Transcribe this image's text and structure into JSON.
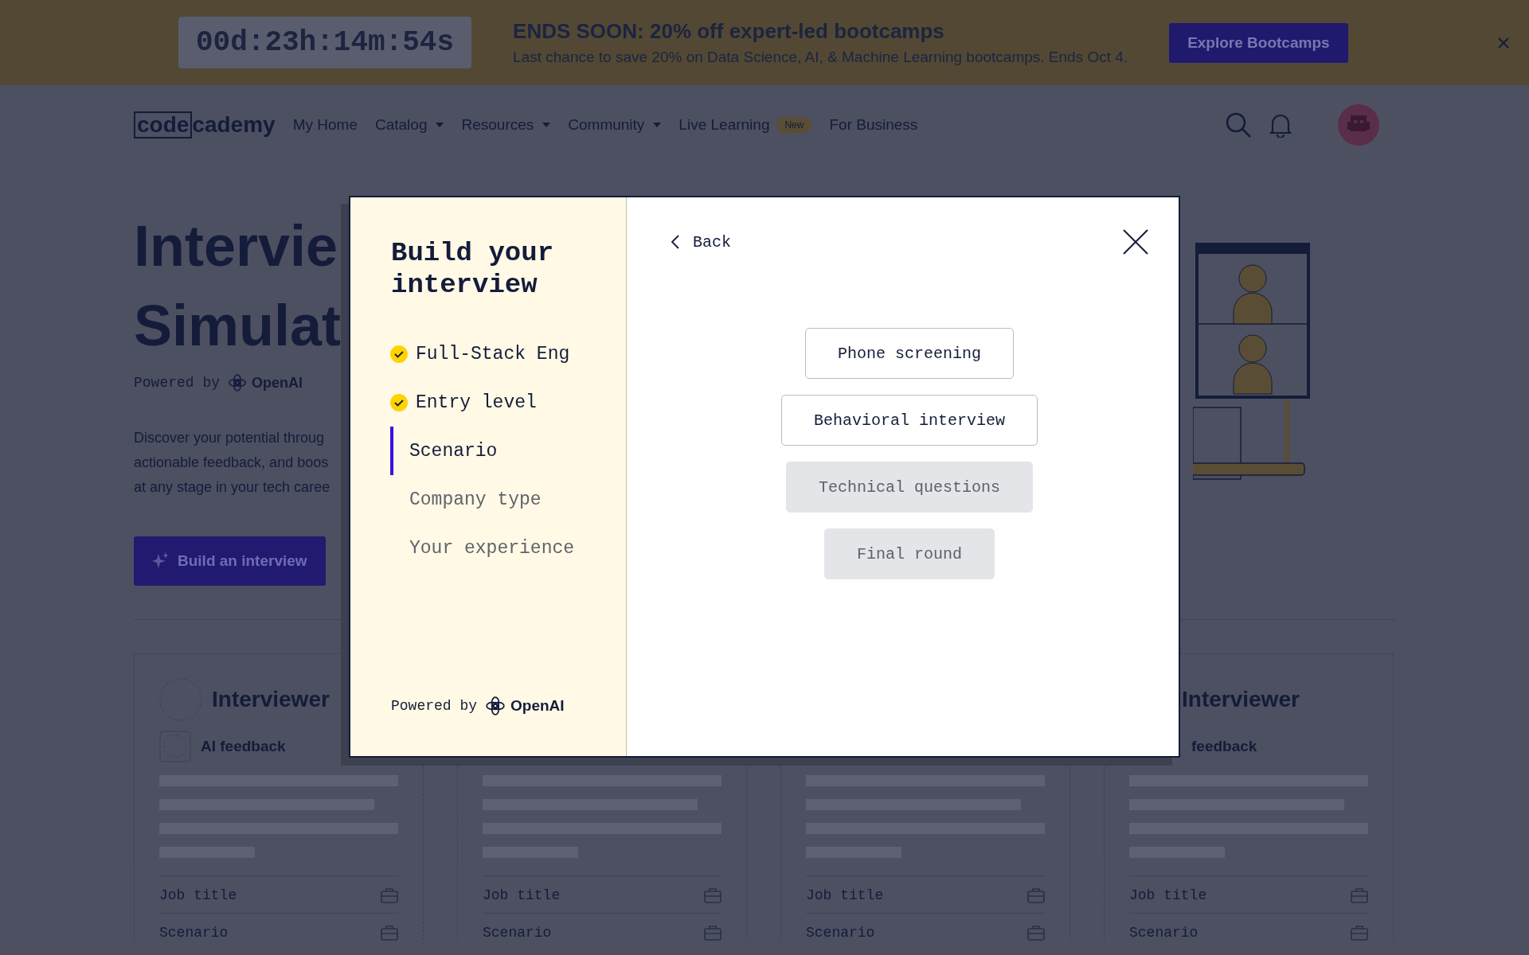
{
  "promo_banner": {
    "countdown": "00d:23h:14m:54s",
    "headline": "ENDS SOON: 20% off expert-led bootcamps",
    "text": "Last chance to save 20% on Data Science, AI, & Machine Learning bootcamps. Ends Oct 4.",
    "button": "Explore Bootcamps"
  },
  "nav": {
    "logo": {
      "boxed": "code",
      "rest": "cademy"
    },
    "items": [
      {
        "label": "My Home",
        "dropdown": false
      },
      {
        "label": "Catalog",
        "dropdown": true
      },
      {
        "label": "Resources",
        "dropdown": true
      },
      {
        "label": "Community",
        "dropdown": true
      },
      {
        "label": "Live Learning",
        "dropdown": false,
        "badge": "New"
      },
      {
        "label": "For Business",
        "dropdown": false
      }
    ]
  },
  "hero": {
    "title_lines": [
      "Intervie",
      "Simulat"
    ],
    "powered_by": "Powered by",
    "brand": "OpenAI",
    "description_lines": [
      "Discover your potential throug",
      "actionable feedback, and boos",
      "at any stage in your tech caree"
    ],
    "button": "Build an interview"
  },
  "cards": [
    {
      "title": "Interviewer",
      "feedback": "AI feedback",
      "rows": [
        "Job title",
        "Scenario"
      ]
    },
    {
      "rows": [
        "Job title",
        "Scenario"
      ]
    },
    {
      "rows": [
        "Job title",
        "Scenario"
      ]
    },
    {
      "title": "Interviewer",
      "feedback": "feedback",
      "rows": [
        "Job title",
        "Scenario"
      ]
    }
  ],
  "modal": {
    "title": "Build your interview",
    "steps": [
      {
        "label": "Full-Stack Eng",
        "kind": "done"
      },
      {
        "label": "Entry level",
        "kind": "done"
      },
      {
        "label": "Scenario",
        "kind": "current"
      },
      {
        "label": "Company type",
        "kind": "todo"
      },
      {
        "label": "Your experience",
        "kind": "todo"
      }
    ],
    "powered_by": "Powered by",
    "brand": "OpenAI",
    "back": "Back",
    "options": [
      {
        "label": "Phone screening",
        "disabled": false
      },
      {
        "label": "Behavioral interview",
        "disabled": false
      },
      {
        "label": "Technical questions",
        "disabled": true
      },
      {
        "label": "Final round",
        "disabled": true
      }
    ]
  }
}
